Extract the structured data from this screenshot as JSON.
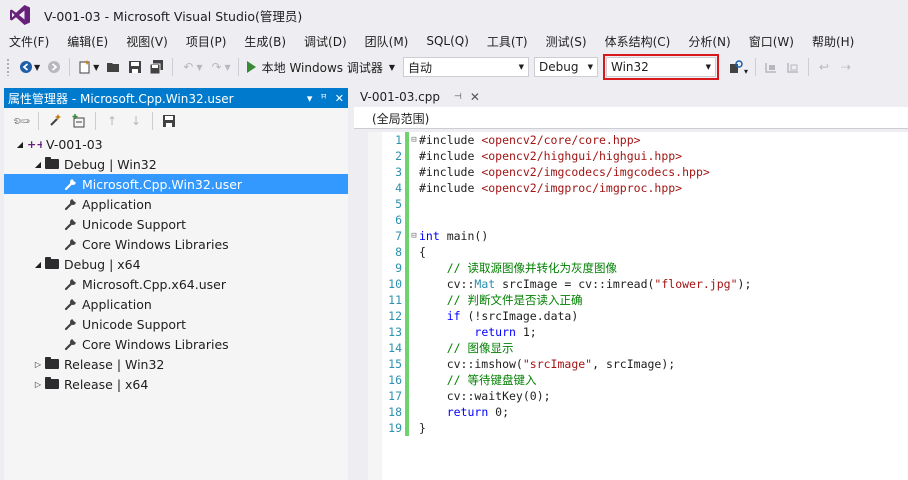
{
  "window": {
    "title": "V-001-03 - Microsoft Visual Studio(管理员)"
  },
  "menu": [
    "文件(F)",
    "编辑(E)",
    "视图(V)",
    "项目(P)",
    "生成(B)",
    "调试(D)",
    "团队(M)",
    "SQL(Q)",
    "工具(T)",
    "测试(S)",
    "体系结构(C)",
    "分析(N)",
    "窗口(W)",
    "帮助(H)"
  ],
  "toolbar": {
    "run_label": "本地 Windows 调试器",
    "solution_config_combo": "自动",
    "config_combo": "Debug",
    "platform_combo": "Win32"
  },
  "panel": {
    "title": "属性管理器 - Microsoft.Cpp.Win32.user",
    "tree": [
      {
        "label": "V-001-03",
        "level": 0,
        "expanded": true,
        "icon": "project-icon"
      },
      {
        "label": "Debug | Win32",
        "level": 1,
        "expanded": true,
        "icon": "folder-icon"
      },
      {
        "label": "Microsoft.Cpp.Win32.user",
        "level": 2,
        "icon": "wrench-icon",
        "selected": true
      },
      {
        "label": "Application",
        "level": 2,
        "icon": "wrench-icon"
      },
      {
        "label": "Unicode Support",
        "level": 2,
        "icon": "wrench-icon"
      },
      {
        "label": "Core Windows Libraries",
        "level": 2,
        "icon": "wrench-icon"
      },
      {
        "label": "Debug | x64",
        "level": 1,
        "expanded": true,
        "icon": "folder-icon"
      },
      {
        "label": "Microsoft.Cpp.x64.user",
        "level": 2,
        "icon": "wrench-icon"
      },
      {
        "label": "Application",
        "level": 2,
        "icon": "wrench-icon"
      },
      {
        "label": "Unicode Support",
        "level": 2,
        "icon": "wrench-icon"
      },
      {
        "label": "Core Windows Libraries",
        "level": 2,
        "icon": "wrench-icon"
      },
      {
        "label": "Release | Win32",
        "level": 1,
        "expanded": false,
        "icon": "folder-icon"
      },
      {
        "label": "Release | x64",
        "level": 1,
        "expanded": false,
        "icon": "folder-icon"
      }
    ]
  },
  "editor": {
    "tab_label": "V-001-03.cpp",
    "scope": "(全局范围)",
    "lines": [
      {
        "n": "1",
        "fold": "⊟",
        "segs": [
          [
            "pp",
            "#include "
          ],
          [
            "str",
            "<opencv2/core/core.hpp>"
          ]
        ]
      },
      {
        "n": "2",
        "fold": "",
        "segs": [
          [
            "pp",
            "#include "
          ],
          [
            "str",
            "<opencv2/highgui/highgui.hpp>"
          ]
        ]
      },
      {
        "n": "3",
        "fold": "",
        "segs": [
          [
            "pp",
            "#include "
          ],
          [
            "str",
            "<opencv2/imgcodecs/imgcodecs.hpp>"
          ]
        ]
      },
      {
        "n": "4",
        "fold": "",
        "segs": [
          [
            "pp",
            "#include "
          ],
          [
            "str",
            "<opencv2/imgproc/imgproc.hpp>"
          ]
        ]
      },
      {
        "n": "5",
        "fold": "",
        "segs": []
      },
      {
        "n": "6",
        "fold": "",
        "segs": []
      },
      {
        "n": "7",
        "fold": "⊟",
        "segs": [
          [
            "kw",
            "int"
          ],
          [
            "plain",
            " main()"
          ]
        ]
      },
      {
        "n": "8",
        "fold": "",
        "segs": [
          [
            "plain",
            "{"
          ]
        ]
      },
      {
        "n": "9",
        "fold": "",
        "segs": [
          [
            "plain",
            "    "
          ],
          [
            "cmt",
            "// 读取源图像并转化为灰度图像"
          ]
        ]
      },
      {
        "n": "10",
        "fold": "",
        "segs": [
          [
            "plain",
            "    cv::"
          ],
          [
            "typ",
            "Mat"
          ],
          [
            "plain",
            " srcImage = cv::imread("
          ],
          [
            "str",
            "\"flower.jpg\""
          ],
          [
            "plain",
            ");"
          ]
        ]
      },
      {
        "n": "11",
        "fold": "",
        "segs": [
          [
            "plain",
            "    "
          ],
          [
            "cmt",
            "// 判断文件是否读入正确"
          ]
        ]
      },
      {
        "n": "12",
        "fold": "",
        "segs": [
          [
            "plain",
            "    "
          ],
          [
            "kw",
            "if"
          ],
          [
            "plain",
            " (!srcImage.data)"
          ]
        ]
      },
      {
        "n": "13",
        "fold": "",
        "segs": [
          [
            "plain",
            "        "
          ],
          [
            "kw",
            "return"
          ],
          [
            "plain",
            " 1;"
          ]
        ]
      },
      {
        "n": "14",
        "fold": "",
        "segs": [
          [
            "plain",
            "    "
          ],
          [
            "cmt",
            "// 图像显示"
          ]
        ]
      },
      {
        "n": "15",
        "fold": "",
        "segs": [
          [
            "plain",
            "    cv::imshow("
          ],
          [
            "str",
            "\"srcImage\""
          ],
          [
            "plain",
            ", srcImage);"
          ]
        ]
      },
      {
        "n": "16",
        "fold": "",
        "segs": [
          [
            "plain",
            "    "
          ],
          [
            "cmt",
            "// 等待键盘键入"
          ]
        ]
      },
      {
        "n": "17",
        "fold": "",
        "segs": [
          [
            "plain",
            "    cv::waitKey(0);"
          ]
        ]
      },
      {
        "n": "18",
        "fold": "",
        "segs": [
          [
            "plain",
            "    "
          ],
          [
            "kw",
            "return"
          ],
          [
            "plain",
            " 0;"
          ]
        ]
      },
      {
        "n": "19",
        "fold": "",
        "segs": [
          [
            "plain",
            "}"
          ]
        ]
      }
    ]
  },
  "colors": {
    "accent": "#007acc",
    "selection": "#3399ff",
    "highlight_box": "#d7191c",
    "change_bar": "#6fd36f"
  }
}
